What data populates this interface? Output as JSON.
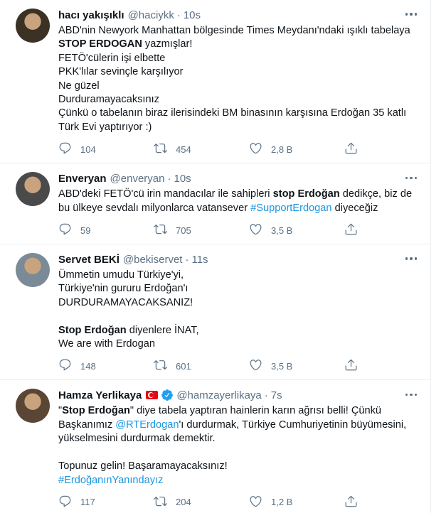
{
  "tweets": [
    {
      "name": "hacı yakışıklı",
      "handle": "@haciykk",
      "time": "10s",
      "avatar_color": "#3b3125",
      "lines": [
        [
          {
            "t": "ABD'nin Newyork Manhattan bölgesinde Times Meydanı'ndaki ışıklı tabelaya"
          }
        ],
        [
          {
            "t": "STOP ERDOGAN",
            "b": true
          },
          {
            "t": " yazmışlar!"
          }
        ],
        [
          {
            "t": "FETÖ'cülerin işi elbette"
          }
        ],
        [
          {
            "t": "PKK'lılar sevinçle karşılıyor"
          }
        ],
        [
          {
            "t": "Ne güzel"
          }
        ],
        [
          {
            "t": "Durduramayacaksınız"
          }
        ],
        [
          {
            "t": "Çünkü o tabelanın biraz ilerisindeki BM binasının karşısına Erdoğan 35 katlı"
          }
        ],
        [
          {
            "t": "Türk Evi yaptırıyor :)"
          }
        ]
      ],
      "replies": "104",
      "retweets": "454",
      "likes": "2,8 B"
    },
    {
      "name": "Enveryan",
      "handle": "@enveryan",
      "time": "10s",
      "avatar_color": "#4a4a4a",
      "lines": [
        [
          {
            "t": "ABD'deki FETÖ'cü irin mandacılar ile sahipleri "
          },
          {
            "t": "stop Erdoğan",
            "b": true
          },
          {
            "t": " dedikçe, biz de"
          }
        ],
        [
          {
            "t": "bu ülkeye sevdalı milyonlarca vatansever "
          },
          {
            "t": "#SupportErdogan",
            "link": true
          },
          {
            "t": " diyeceğiz"
          }
        ]
      ],
      "replies": "59",
      "retweets": "705",
      "likes": "3,5 B"
    },
    {
      "name": "Servet BEKİ",
      "handle": "@bekiservet",
      "time": "11s",
      "avatar_color": "#7a8a96",
      "lines": [
        [
          {
            "t": "Ümmetin umudu Türkiye'yi,"
          }
        ],
        [
          {
            "t": "Türkiye'nin gururu Erdoğan'ı"
          }
        ],
        [
          {
            "t": "DURDURAMAYACAKSANIZ!"
          }
        ],
        [],
        [
          {
            "t": "Stop Erdoğan",
            "b": true
          },
          {
            "t": " diyenlere İNAT,"
          }
        ],
        [
          {
            "t": "We are with Erdogan"
          }
        ]
      ],
      "replies": "148",
      "retweets": "601",
      "likes": "3,5 B"
    },
    {
      "name": "Hamza Yerlikaya",
      "handle": "@hamzayerlikaya",
      "time": "7s",
      "avatar_color": "#5a4634",
      "flag": true,
      "verified": true,
      "lines": [
        [
          {
            "t": "\""
          },
          {
            "t": "Stop Erdoğan",
            "b": true
          },
          {
            "t": "\" diye tabela yaptıran hainlerin karın ağrısı belli! Çünkü"
          }
        ],
        [
          {
            "t": "Başkanımız "
          },
          {
            "t": "@RTErdogan",
            "link": true
          },
          {
            "t": "'ı durdurmak, Türkiye Cumhuriyetinin büyümesini,"
          }
        ],
        [
          {
            "t": "yükselmesini durdurmak demektir."
          }
        ],
        [],
        [
          {
            "t": "Topunuz gelin! Başaramayacaksınız!"
          }
        ],
        [
          {
            "t": "#ErdoğanınYanındayız",
            "link": true
          }
        ]
      ],
      "replies": "117",
      "retweets": "204",
      "likes": "1,2 B"
    }
  ],
  "icons": {
    "reply": "reply-icon",
    "retweet": "retweet-icon",
    "like": "heart-icon",
    "share": "share-icon",
    "more": "more-icon"
  },
  "colors": {
    "link": "#1b95e0",
    "secondary_text": "#5b7083",
    "divider": "#ebeef0",
    "verified": "#1da1f2",
    "flag": "#e30a17"
  }
}
